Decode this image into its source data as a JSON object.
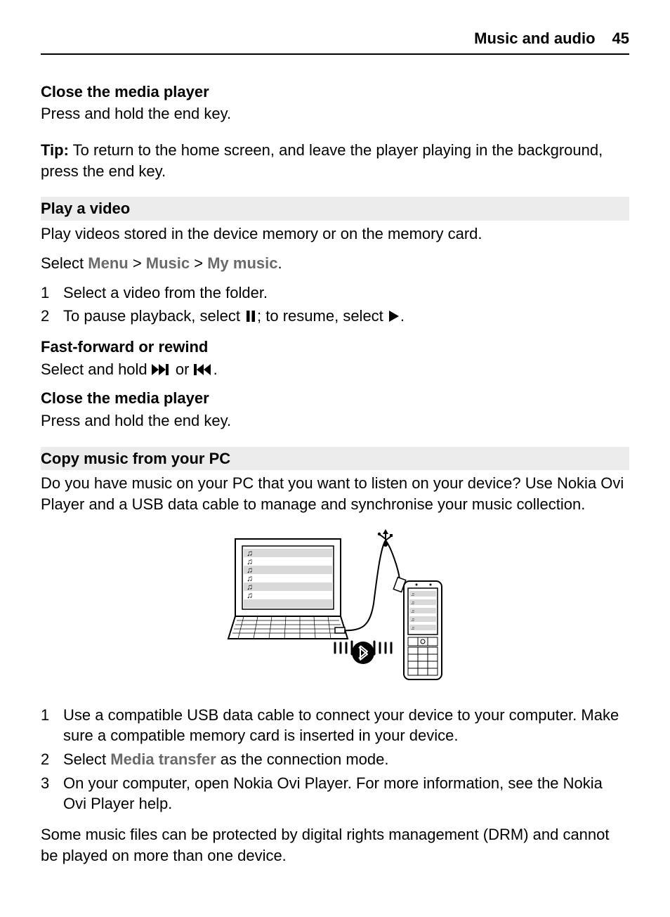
{
  "header": {
    "title": "Music and audio",
    "page": "45"
  },
  "s1": {
    "heading": "Close the media player",
    "body": "Press and hold the end key."
  },
  "tip": {
    "label": "Tip:",
    "body": " To return to the home screen, and leave the player playing in the background, press the end key."
  },
  "s2": {
    "heading": "Play a video",
    "intro": "Play videos stored in the device memory or on the memory card.",
    "select_label": "Select ",
    "path1": "Menu",
    "gt1": " > ",
    "path2": "Music",
    "gt2": " > ",
    "path3": "My music",
    "period": ".",
    "step1_num": "1",
    "step1_text": "Select a video from the folder.",
    "step2_num": "2",
    "step2_pre": "To pause playback, select ",
    "step2_mid": "; to resume, select ",
    "step2_post": "."
  },
  "s3": {
    "heading": "Fast-forward or rewind",
    "pre": "Select and hold ",
    "mid": " or ",
    "post": "."
  },
  "s4": {
    "heading": "Close the media player",
    "body": "Press and hold the end key."
  },
  "s5": {
    "heading": "Copy music from your PC",
    "intro": "Do you have music on your PC that you want to listen on your device? Use Nokia Ovi Player and a USB data cable to manage and synchronise your music collection.",
    "step1_num": "1",
    "step1_text": "Use a compatible USB data cable to connect your device to your computer. Make sure a compatible memory card is inserted in your device.",
    "step2_num": "2",
    "step2_pre": "Select ",
    "step2_bold": "Media transfer",
    "step2_post": " as the connection mode.",
    "step3_num": "3",
    "step3_text": "On your computer, open Nokia Ovi Player. For more information, see the Nokia Ovi Player help.",
    "outro": "Some music files can be protected by digital rights management (DRM) and cannot be played on more than one device."
  }
}
